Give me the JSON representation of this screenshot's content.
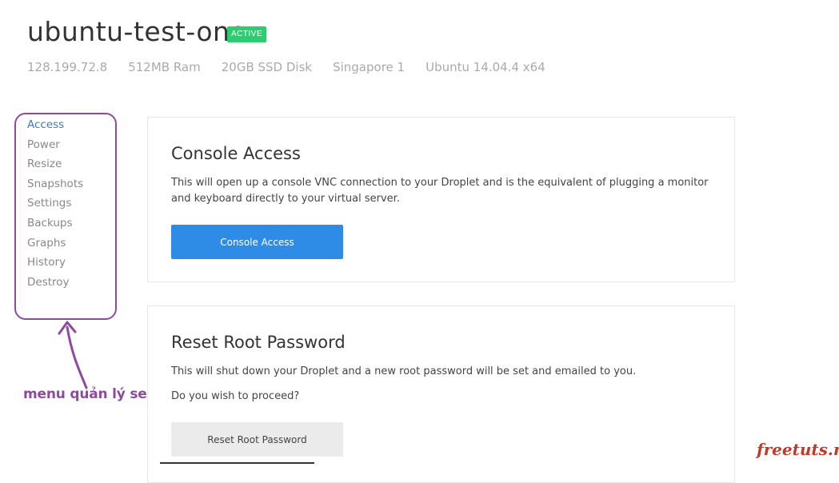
{
  "droplet": {
    "name": "ubuntu-test-one",
    "status": "ACTIVE",
    "meta": [
      "128.199.72.8",
      "512MB Ram",
      "20GB SSD Disk",
      "Singapore 1",
      "Ubuntu 14.04.4 x64"
    ]
  },
  "sidebar": {
    "items": [
      {
        "label": "Access"
      },
      {
        "label": "Power"
      },
      {
        "label": "Resize"
      },
      {
        "label": "Snapshots"
      },
      {
        "label": "Settings"
      },
      {
        "label": "Backups"
      },
      {
        "label": "Graphs"
      },
      {
        "label": "History"
      },
      {
        "label": "Destroy"
      }
    ]
  },
  "console": {
    "title": "Console Access",
    "description": "This will open up a console VNC connection to your Droplet and is the equivalent of plugging a monitor and keyboard directly to your virtual server.",
    "button_label": "Console Access"
  },
  "reset": {
    "title": "Reset Root Password",
    "description": "This will shut down your Droplet and a new root password will be set and emailed to you.",
    "question": "Do you wish to proceed?",
    "button_label": "Reset Root Password"
  },
  "annotation": {
    "text": "menu quản lý server"
  },
  "watermark": "freetuts.net",
  "colors": {
    "status_active": "#2ecc71",
    "primary_button": "#2f8ce6",
    "annotation": "#8e4a9e",
    "active_link": "#3a7bbf"
  }
}
